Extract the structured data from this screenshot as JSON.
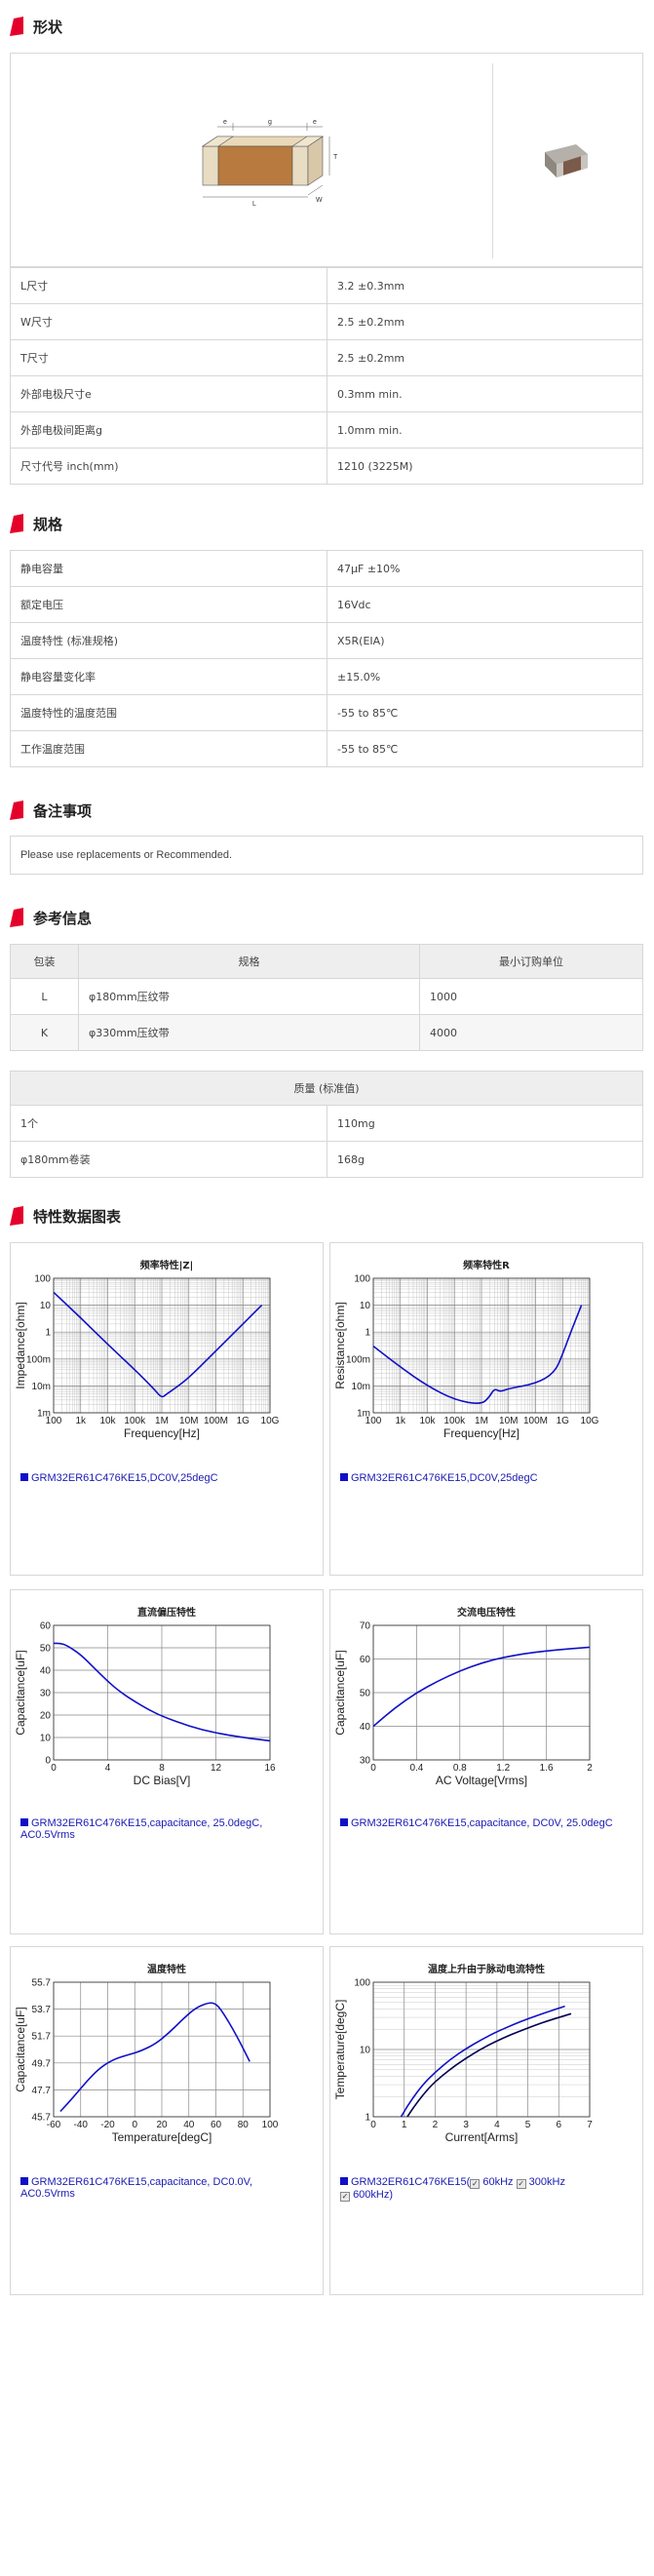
{
  "sections": {
    "shape": "形状",
    "spec": "规格",
    "notes": "备注事项",
    "reference": "参考信息",
    "charts": "特性数据图表"
  },
  "diagram": {
    "e": "e",
    "g": "g",
    "t": "T",
    "l": "L",
    "w": "W"
  },
  "shape_rows": [
    {
      "label": "L尺寸",
      "value": "3.2 ±0.3mm"
    },
    {
      "label": "W尺寸",
      "value": "2.5 ±0.2mm"
    },
    {
      "label": "T尺寸",
      "value": "2.5 ±0.2mm"
    },
    {
      "label": "外部电极尺寸e",
      "value": "0.3mm min."
    },
    {
      "label": "外部电极间距离g",
      "value": "1.0mm min."
    },
    {
      "label": "尺寸代号 inch(mm)",
      "value": "1210 (3225M)"
    }
  ],
  "spec_rows": [
    {
      "label": "静电容量",
      "value": "47μF ±10%"
    },
    {
      "label": "额定电压",
      "value": "16Vdc"
    },
    {
      "label": "温度特性 (标准规格)",
      "value": "X5R(EIA)"
    },
    {
      "label": "静电容量变化率",
      "value": "±15.0%"
    },
    {
      "label": "温度特性的温度范围",
      "value": "-55 to 85℃"
    },
    {
      "label": "工作温度范围",
      "value": "-55 to 85℃"
    }
  ],
  "notes_text": "Please use replacements or Recommended.",
  "packaging": {
    "headers": [
      "包装",
      "规格",
      "最小订购单位"
    ],
    "rows": [
      {
        "code": "L",
        "spec": "φ180mm压纹带",
        "min": "1000"
      },
      {
        "code": "K",
        "spec": "φ330mm压纹带",
        "min": "4000"
      }
    ]
  },
  "mass": {
    "header": "质量 (标准值)",
    "rows": [
      {
        "label": "1个",
        "value": "110mg"
      },
      {
        "label": "φ180mm卷装",
        "value": "168g"
      }
    ]
  },
  "chart_data": [
    {
      "type": "line",
      "title": "频率特性|Z|",
      "xlabel": "Frequency[Hz]",
      "ylabel": "Impedance[ohm]",
      "x_scale": "log",
      "y_scale": "log",
      "xticks": [
        "100",
        "1k",
        "10k",
        "100k",
        "1M",
        "10M",
        "100M",
        "1G",
        "10G"
      ],
      "yticks": [
        "100",
        "10",
        "1",
        "100m",
        "10m",
        "1m"
      ],
      "xlim": [
        100,
        10000000000
      ],
      "ylim": [
        0.001,
        100
      ],
      "series": [
        {
          "x": [
            100,
            1000,
            10000,
            100000,
            500000,
            1000000,
            1500000,
            3000000,
            10000000,
            100000000,
            1000000000,
            5000000000
          ],
          "y": [
            30,
            3.4,
            0.35,
            0.04,
            0.008,
            0.0035,
            0.005,
            0.008,
            0.02,
            0.2,
            2,
            10
          ]
        }
      ],
      "legend": "GRM32ER61C476KE15,DC0V,25degC"
    },
    {
      "type": "line",
      "title": "频率特性R",
      "xlabel": "Frequency[Hz]",
      "ylabel": "Resistance[ohm]",
      "x_scale": "log",
      "y_scale": "log",
      "xticks": [
        "100",
        "1k",
        "10k",
        "100k",
        "1M",
        "10M",
        "100M",
        "1G",
        "10G"
      ],
      "yticks": [
        "100",
        "10",
        "1",
        "100m",
        "10m",
        "1m"
      ],
      "xlim": [
        100,
        10000000000
      ],
      "ylim": [
        0.001,
        100
      ],
      "series": [
        {
          "x": [
            100,
            1000,
            10000,
            100000,
            1000000,
            2000000,
            3000000,
            5000000,
            10000000,
            100000000,
            500000000,
            1000000000,
            2000000000,
            5000000000
          ],
          "y": [
            0.3,
            0.05,
            0.01,
            0.003,
            0.002,
            0.004,
            0.008,
            0.006,
            0.008,
            0.012,
            0.03,
            0.15,
            1,
            10
          ]
        }
      ],
      "legend": "GRM32ER61C476KE15,DC0V,25degC"
    },
    {
      "type": "line",
      "title": "直流偏压特性",
      "xlabel": "DC Bias[V]",
      "ylabel": "Capacitance[uF]",
      "xticks": [
        "0",
        "4",
        "8",
        "12",
        "16"
      ],
      "yticks": [
        "0",
        "10",
        "20",
        "30",
        "40",
        "50",
        "60"
      ],
      "xlim": [
        0,
        16
      ],
      "ylim": [
        0,
        60
      ],
      "series": [
        {
          "x": [
            0,
            0.5,
            1,
            2,
            3,
            4,
            5,
            6,
            7,
            8,
            10,
            12,
            14,
            16
          ],
          "y": [
            52,
            52,
            51,
            47,
            41,
            35,
            30,
            26,
            22.5,
            19.5,
            15,
            12,
            10,
            8.5
          ]
        }
      ],
      "legend": "GRM32ER61C476KE15,capacitance, 25.0degC, AC0.5Vrms"
    },
    {
      "type": "line",
      "title": "交流电压特性",
      "xlabel": "AC Voltage[Vrms]",
      "ylabel": "Capacitance[uF]",
      "xticks": [
        "0",
        "0.4",
        "0.8",
        "1.2",
        "1.6",
        "2"
      ],
      "yticks": [
        "30",
        "40",
        "50",
        "60",
        "70"
      ],
      "xlim": [
        0,
        2
      ],
      "ylim": [
        30,
        70
      ],
      "series": [
        {
          "x": [
            0,
            0.2,
            0.4,
            0.6,
            0.8,
            1.0,
            1.2,
            1.4,
            1.6,
            1.8,
            2.0
          ],
          "y": [
            40,
            45.5,
            50,
            53.5,
            56.5,
            58.8,
            60.5,
            61.6,
            62.4,
            63,
            63.5
          ]
        }
      ],
      "legend": "GRM32ER61C476KE15,capacitance, DC0V, 25.0degC"
    },
    {
      "type": "line",
      "title": "温度特性",
      "xlabel": "Temperature[degC]",
      "ylabel": "Capacitance[uF]",
      "xticks": [
        "-60",
        "-40",
        "-20",
        "0",
        "20",
        "40",
        "60",
        "80",
        "100"
      ],
      "yticks": [
        "45.7",
        "47.7",
        "49.7",
        "51.7",
        "53.7",
        "55.7"
      ],
      "xlim": [
        -60,
        100
      ],
      "ylim": [
        45.7,
        55.7
      ],
      "series": [
        {
          "x": [
            -55,
            -45,
            -35,
            -25,
            -15,
            -5,
            5,
            15,
            25,
            35,
            45,
            55,
            60,
            65,
            75,
            85
          ],
          "y": [
            46.1,
            47.2,
            48.4,
            49.4,
            50.0,
            50.3,
            50.6,
            51.1,
            51.9,
            52.9,
            53.8,
            54.2,
            54.1,
            53.5,
            51.8,
            49.8
          ]
        }
      ],
      "legend": "GRM32ER61C476KE15,capacitance, DC0.0V, AC0.5Vrms"
    },
    {
      "type": "line",
      "title": "温度上升由于脉动电流特性",
      "xlabel": "Current[Arms]",
      "ylabel": "Temperature[degC]",
      "y_scale": "log",
      "xticks": [
        "0",
        "1",
        "2",
        "3",
        "4",
        "5",
        "6",
        "7"
      ],
      "yticks": [
        "100",
        "10",
        "1"
      ],
      "xlim": [
        0,
        7
      ],
      "ylim": [
        1,
        100
      ],
      "series": [
        {
          "name": "60kHz",
          "x": [
            0.9,
            1.2,
            1.6,
            2.0,
            2.5,
            3.0,
            3.5,
            4.0,
            4.5,
            5.0,
            5.5,
            6.2
          ],
          "y": [
            1,
            1.7,
            3.0,
            4.6,
            7.2,
            10.3,
            14,
            18.4,
            23.2,
            28.6,
            34.5,
            44
          ]
        },
        {
          "name": "300kHz",
          "x": [
            1.1,
            1.4,
            1.8,
            2.2,
            2.7,
            3.2,
            3.7,
            4.2,
            4.7,
            5.2,
            5.7,
            6.4
          ],
          "y": [
            1,
            1.6,
            2.7,
            4.0,
            6.0,
            8.5,
            11.5,
            14.8,
            18.5,
            22.6,
            27.2,
            34
          ]
        }
      ],
      "legend": "GRM32ER61C476KE15(",
      "legend_items": [
        "60kHz",
        "300kHz",
        "600kHz)"
      ]
    }
  ],
  "colors": {
    "accent": "#e4002b",
    "line": "#1010c8",
    "grid": "#888888"
  }
}
